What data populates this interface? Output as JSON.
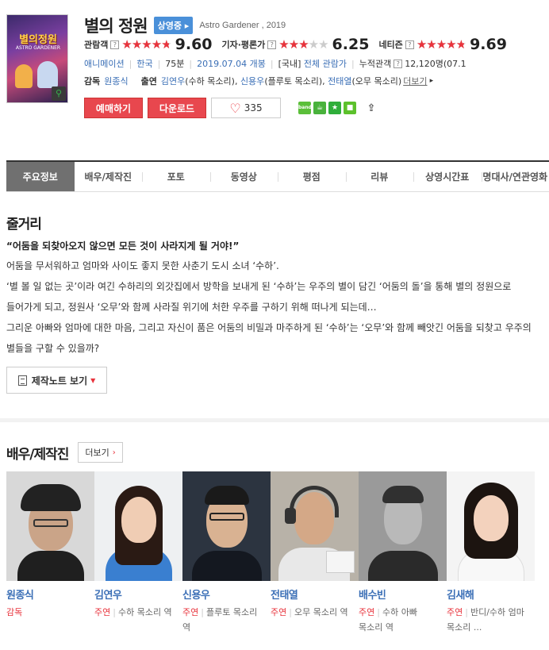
{
  "movie": {
    "title": "별의 정원",
    "status_badge": "상영중",
    "original_title": "Astro Gardener , 2019"
  },
  "poster": {
    "title_text": "별의정원",
    "subtitle_text": "ASTRO GARDENER"
  },
  "ratings": [
    {
      "label": "관람객",
      "score": "9.60",
      "fraction": 0.96
    },
    {
      "label": "기자·평론가",
      "score": "6.25",
      "fraction": 0.625
    },
    {
      "label": "네티즌",
      "score": "9.69",
      "fraction": 0.969
    }
  ],
  "meta": {
    "genre": "애니메이션",
    "country": "한국",
    "runtime": "75분",
    "release": "2019.07.04 개봉",
    "rating_prefix": "[국내]",
    "rating": "전체 관람가",
    "audience_label": "누적관객",
    "audience_value": "12,120명",
    "audience_date": "(07.1"
  },
  "credits": {
    "director_label": "감독",
    "director": "원종식",
    "cast_label": "출연",
    "cast": [
      {
        "name": "김연우",
        "role": "(수하 목소리)"
      },
      {
        "name": "신용우",
        "role": "(플루토 목소리)"
      },
      {
        "name": "전태열",
        "role": "(오무 목소리)"
      }
    ],
    "more": "더보기"
  },
  "buttons": {
    "reserve": "예매하기",
    "download": "다운로드",
    "likes": "335"
  },
  "share": {
    "band": "band",
    "story": "☕",
    "star": "★",
    "msg": "■",
    "share": "⇪"
  },
  "tabs": [
    "주요정보",
    "배우/제작진",
    "포토",
    "동영상",
    "평점",
    "리뷰",
    "상영시간표",
    "명대사/연관영화"
  ],
  "synopsis": {
    "heading": "줄거리",
    "lead": "“어둠을 되찾아오지 않으면 모든 것이 사라지게 될 거야!”",
    "p1": "어둠을 무서워하고 엄마와 사이도 좋지 못한 사춘기 도시 소녀 ‘수하’.",
    "p2": " ‘별 볼 일 없는 곳’이라 여긴 수하리의 외갓집에서 방학을 보내게 된 ‘수하’는 우주의 별이 담긴 ‘어둠의 돌’을 통해 별의 정원으로 들어가게 되고, 정원사 ‘오무’와 함께 사라질 위기에 처한 우주를 구하기 위해 떠나게 되는데…",
    "p3": " 그리운 아빠와 엄마에 대한 마음, 그리고 자신이 품은 어둠의 비밀과 마주하게 된 ‘수하’는 ‘오무’와 함께 빼앗긴 어둠을 되찾고 우주의 별들을 구할 수 있을까?",
    "note_button": "제작노트 보기"
  },
  "cast_section": {
    "heading": "배우/제작진",
    "more": "더보기",
    "people": [
      {
        "name": "원종식",
        "type": "감독",
        "role": ""
      },
      {
        "name": "김연우",
        "type": "주연",
        "role": "수하 목소리 역"
      },
      {
        "name": "신용우",
        "type": "주연",
        "role": "플루토 목소리 역"
      },
      {
        "name": "전태열",
        "type": "주연",
        "role": "오무 목소리 역"
      },
      {
        "name": "배수빈",
        "type": "주연",
        "role": "수하 아빠 목소리 역"
      },
      {
        "name": "김새해",
        "type": "주연",
        "role": "반디/수하 엄마 목소리 ..."
      }
    ]
  }
}
